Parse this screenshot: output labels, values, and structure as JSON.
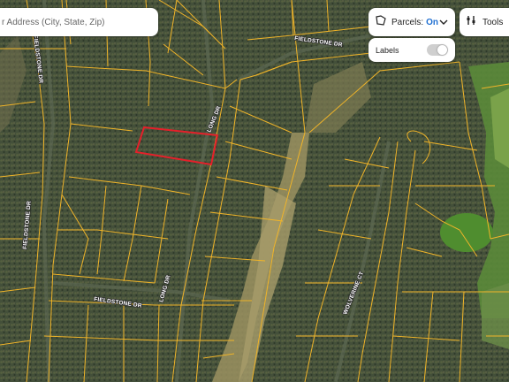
{
  "search": {
    "placeholder": "r Address (City, State, Zip)"
  },
  "parcels_control": {
    "label": "Parcels:",
    "state": "On",
    "icon": "parcel-layer-icon",
    "dropdown_icon": "chevron-down-icon"
  },
  "tools_control": {
    "label": "Tools",
    "icon": "tools-icon"
  },
  "labels_control": {
    "label": "Labels",
    "toggle_on": false
  },
  "road_labels": {
    "fieldstone_top": "FIELDSTONE DR",
    "fieldstone_left_top": "FIELDSTONE DR",
    "fieldstone_left": "FIELDSTONE DR",
    "fieldstone_bottom": "FIELDSTONE DR",
    "long_dr_top": "LONG DR",
    "long_dr_bottom": "LONG DR",
    "wolverine_ct": "WOLVERINE CT"
  },
  "colors": {
    "parcel_line": "#f0b429",
    "selected_parcel": "#e5202a",
    "forest": "#45523a",
    "clearing": "#9a9060",
    "fairway": "#4f8d2f",
    "accent": "#1f6fd1"
  }
}
